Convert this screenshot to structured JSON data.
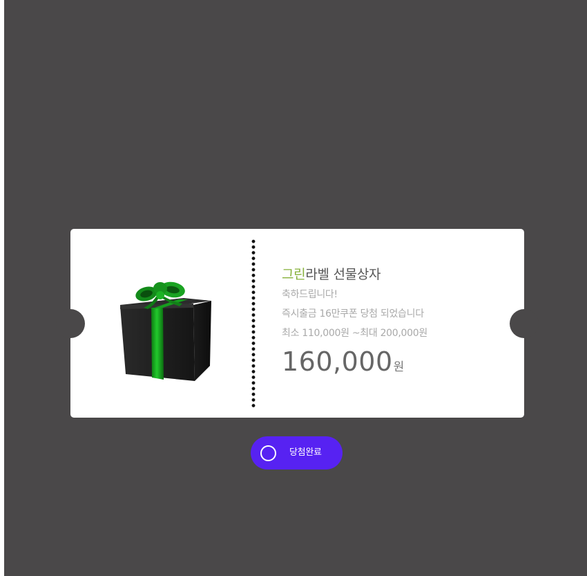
{
  "coupon": {
    "title_brand": "그린",
    "title_rest": "라벨 선물상자",
    "message": "축하드립니다!",
    "detail": "즉시출금 16만쿠폰 당첨 되었습니다",
    "range": "최소 110,000원 ~최대 200,000원",
    "amount": "160,000",
    "unit": "원",
    "image": "gift-box-icon"
  },
  "action": {
    "label": "당첨완료",
    "icon": "circle-icon"
  },
  "colors": {
    "backdrop": "#4a4849",
    "brand_text": "#86b13a",
    "button": "#5722f2",
    "ribbon": "#1fbf2a"
  }
}
